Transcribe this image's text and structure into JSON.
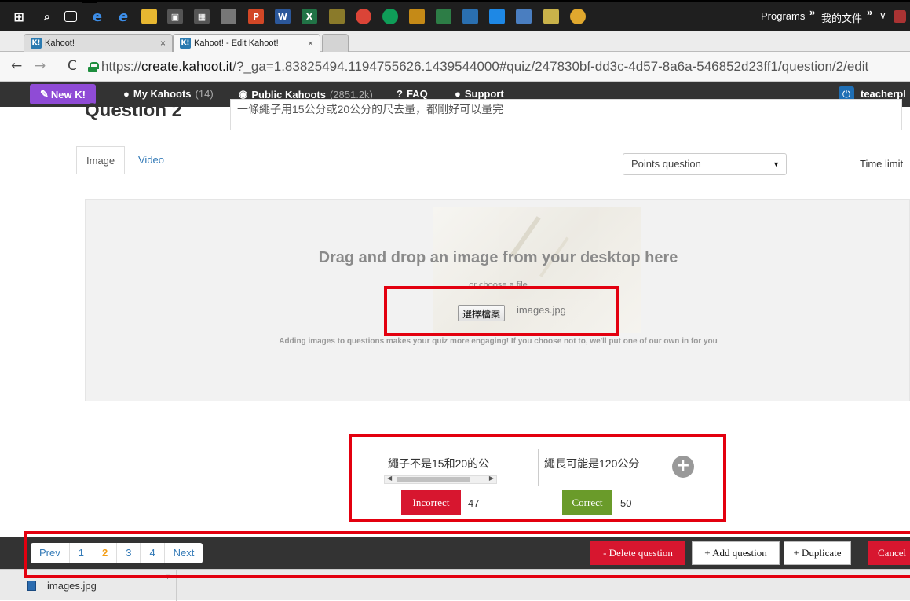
{
  "taskbar": {
    "icons": [
      "windows-icon",
      "search-icon",
      "task-view-icon",
      "ie-icon",
      "edge-icon",
      "file-explorer-icon",
      "store-icon",
      "calculator-icon",
      "app-icon",
      "powerpoint-icon",
      "word-icon",
      "excel-icon",
      "app-icon-2",
      "chrome-icon",
      "chrome-icon-2",
      "app-icon-3",
      "app-icon-4",
      "app-icon-5",
      "app-icon-6",
      "app-icon-7",
      "app-icon-8",
      "chrome-icon-3"
    ],
    "programs_label": "Programs",
    "documents_label": "我的文件",
    "chevron": "»"
  },
  "browser": {
    "tabs": [
      {
        "title": "Kahoot!",
        "active": false
      },
      {
        "title": "Kahoot! - Edit Kahoot!",
        "active": true
      }
    ],
    "url_scheme": "https://",
    "url_host": "create.kahoot.it",
    "url_rest": "/?_ga=1.83825494.1194755626.1439544000#quiz/247830bf-dd3c-4d57-8a6a-546852d23ff1/question/2/edit"
  },
  "appnav": {
    "new_label": "New K!",
    "my_kahoots_label": "My Kahoots",
    "my_kahoots_count": "(14)",
    "public_label": "Public Kahoots",
    "public_count": "(2851.2k)",
    "faq_label": "FAQ",
    "support_label": "Support",
    "user_name": "teacherpl"
  },
  "question": {
    "title": "Question 2",
    "text": "一條繩子用15公分或20公分的尺去量，都剛好可以量完"
  },
  "media_tabs": {
    "image_label": "Image",
    "video_label": "Video"
  },
  "question_type": {
    "selected": "Points question"
  },
  "time_limit_label": "Time limit",
  "dropzone": {
    "title": "Drag and drop an image from your desktop here",
    "choose_text": "or choose a file",
    "file_button_label": "選擇檔案",
    "file_name": "images.jpg",
    "hint": "Adding images to questions makes your quiz more engaging! If you choose not to, we'll put one of our own in for you"
  },
  "answers": [
    {
      "text": "繩子不是15和20的公",
      "status_label": "Incorrect",
      "count": "47"
    },
    {
      "text": "繩長可能是120公分",
      "status_label": "Correct",
      "count": "50"
    }
  ],
  "pager": {
    "prev_label": "Prev",
    "pages": [
      "1",
      "2",
      "3",
      "4"
    ],
    "current_page": "2",
    "next_label": "Next"
  },
  "actions": {
    "delete_label": "- Delete question",
    "add_label": "+ Add question",
    "duplicate_label": "+ Duplicate",
    "cancel_label": "Cancel"
  },
  "downloads": {
    "file_name": "images.jpg"
  },
  "colors": {
    "new_button": "#8f4bd6",
    "incorrect": "#d7162f",
    "correct": "#6a9b2a",
    "annotation": "#e3000f",
    "link": "#337ab7",
    "current_page": "#f39c12"
  }
}
